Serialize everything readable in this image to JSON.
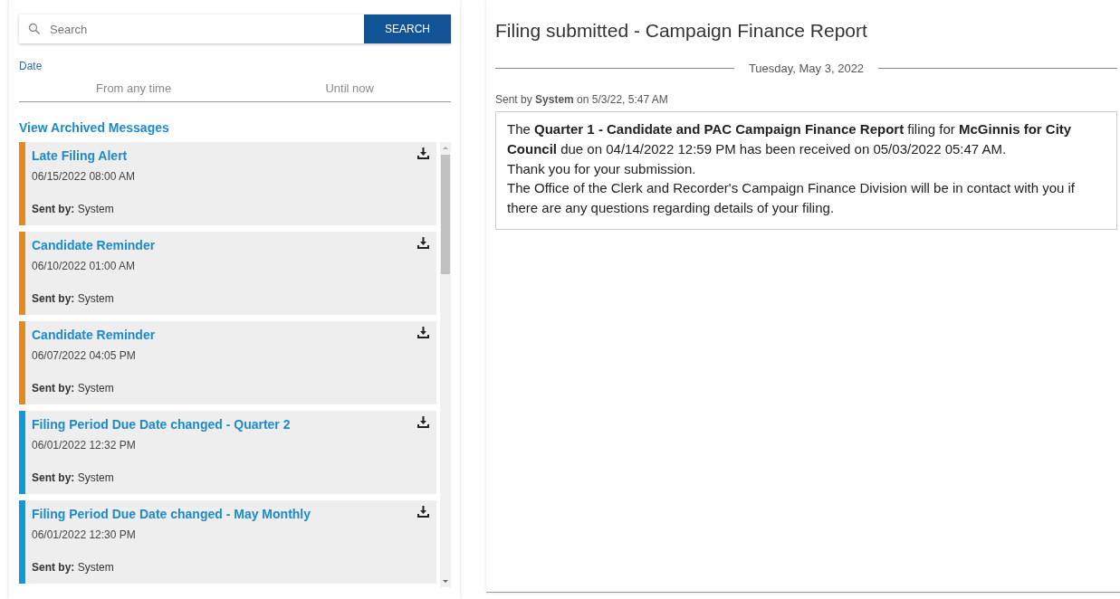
{
  "search": {
    "placeholder": "Search",
    "button": "SEARCH"
  },
  "date_filter": {
    "label": "Date",
    "from": "From any time",
    "until": "Until now"
  },
  "archived_link": "View Archived Messages",
  "messages": [
    {
      "title": "Late Filing Alert",
      "date": "06/15/2022 08:00 AM",
      "sent_by_label": "Sent by:",
      "sender": "System",
      "color": "#e68a1f"
    },
    {
      "title": "Candidate Reminder",
      "date": "06/10/2022 01:00 AM",
      "sent_by_label": "Sent by:",
      "sender": "System",
      "color": "#e68a1f"
    },
    {
      "title": "Candidate Reminder",
      "date": "06/07/2022 04:05 PM",
      "sent_by_label": "Sent by:",
      "sender": "System",
      "color": "#e68a1f"
    },
    {
      "title": "Filing Period Due Date changed - Quarter 2",
      "date": "06/01/2022 12:32 PM",
      "sent_by_label": "Sent by:",
      "sender": "System",
      "color": "#0f9ad6"
    },
    {
      "title": "Filing Period Due Date changed - May Monthly",
      "date": "06/01/2022 12:30 PM",
      "sent_by_label": "Sent by:",
      "sender": "System",
      "color": "#0f9ad6"
    }
  ],
  "detail": {
    "title": "Filing submitted - Campaign Finance Report",
    "day": "Tuesday, May 3, 2022",
    "meta": "Sent by **System** on 5/3/22, 5:47 AM",
    "body": [
      "The **Quarter 1 - Candidate and PAC Campaign Finance Report** filing for **McGinnis for City Council** due on 04/14/2022 12:59 PM has been received on 05/03/2022 05:47 AM.",
      "Thank you for your submission.",
      "The Office of the Clerk and Recorder's Campaign Finance Division will be in contact with you if there are any questions regarding details of your filing."
    ]
  }
}
